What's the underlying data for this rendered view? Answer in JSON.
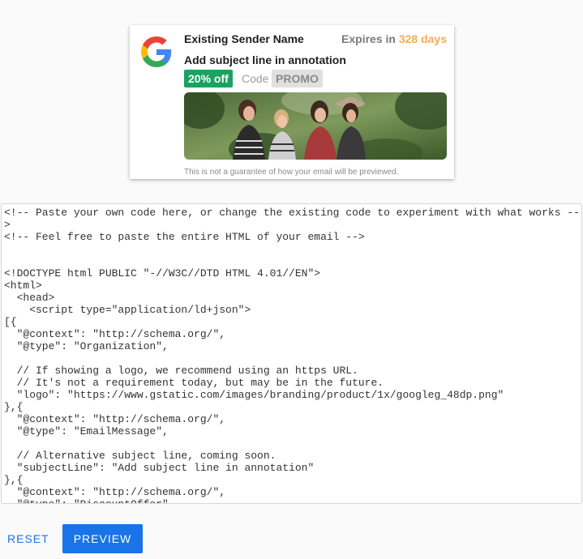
{
  "preview": {
    "sender_name": "Existing Sender Name",
    "expires_prefix": "Expires in",
    "expires_days": "328 days",
    "subject_line": "Add subject line in annotation",
    "discount_badge": "20% off",
    "code_label": "Code",
    "code_value": "PROMO",
    "disclaimer": "This is not a guarantee of how your email will be previewed.",
    "logo_icon": "google-g-logo-icon",
    "image_subject": "promo-photo"
  },
  "editor": {
    "lines": [
      "<!-- Paste your own code here, or change the existing code to experiment with what works --",
      ">",
      "<!-- Feel free to paste the entire HTML of your email -->",
      "",
      "",
      "<!DOCTYPE html PUBLIC \"-//W3C//DTD HTML 4.01//EN\">",
      "<html>",
      "  <head>",
      "    <script type=\"application/ld+json\">",
      "[{",
      "  \"@context\": \"http://schema.org/\",",
      "  \"@type\": \"Organization\",",
      "",
      "  // If showing a logo, we recommend using an https URL.",
      "  // It's not a requirement today, but may be in the future.",
      "  \"logo\": \"https://www.gstatic.com/images/branding/product/1x/googleg_48dp.png\"",
      "},{",
      "  \"@context\": \"http://schema.org/\",",
      "  \"@type\": \"EmailMessage\",",
      "",
      "  // Alternative subject line, coming soon.",
      "  \"subjectLine\": \"Add subject line in annotation\"",
      "},{",
      "  \"@context\": \"http://schema.org/\",",
      "  \"@type\": \"DiscountOffer\","
    ]
  },
  "actions": {
    "reset_label": "RESET",
    "preview_label": "PREVIEW"
  },
  "colors": {
    "accent": "#1a73e8",
    "discount_green": "#1aa260",
    "expires_orange": "#f6ad55"
  }
}
